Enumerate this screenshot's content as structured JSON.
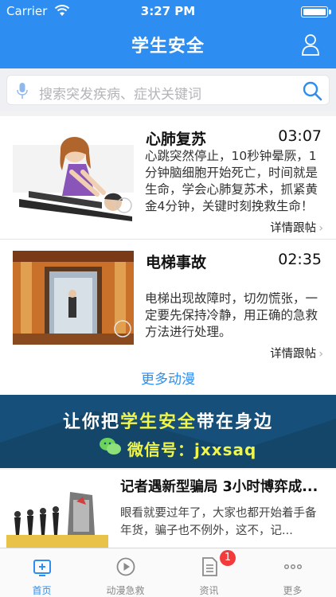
{
  "status_bar": {
    "carrier": "Carrier",
    "time": "3:27 PM"
  },
  "nav": {
    "title": "学生安全",
    "user_icon": "user-icon"
  },
  "search": {
    "placeholder": "搜索突发疾病、症状关键词",
    "mic_icon": "microphone-icon",
    "search_icon": "search-icon"
  },
  "list": {
    "items": [
      {
        "title": "心肺复苏",
        "duration": "03:07",
        "description": "心跳突然停止，10秒钟晕厥，1分钟脑细胞开始死亡，时间就是生命，学会心肺复苏术，抓紧黄金4分钟，关键时刻挽救生命！",
        "detail_label": "详情跟帖"
      },
      {
        "title": "电梯事故",
        "duration": "02:35",
        "description": "电梯出现故障时，切勿慌张，一定要先保持冷静，用正确的急救方法进行处理。",
        "detail_label": "详情跟帖"
      }
    ],
    "more_label": "更多动漫"
  },
  "banner": {
    "line1_before": "让你把",
    "line1_highlight": "学生安全",
    "line1_after": "带在身边",
    "line2": "微信号：jxxsaq"
  },
  "news": {
    "title": "记者遇新型骗局 3小时博弈成...",
    "description": "眼看就要过年了，大家也都开始着手备年货，骗子也不例外，这不，记..."
  },
  "tabbar": {
    "tabs": [
      {
        "label": "首页",
        "icon": "home-icon",
        "active": true
      },
      {
        "label": "动漫急救",
        "icon": "play-icon",
        "active": false
      },
      {
        "label": "资讯",
        "icon": "document-icon",
        "active": false,
        "badge": "1"
      },
      {
        "label": "更多",
        "icon": "more-icon",
        "active": false
      }
    ]
  },
  "colors": {
    "accent": "#2d8df0",
    "badge": "#f23b3b",
    "banner_bg": "#14476e",
    "banner_highlight": "#f0f54a"
  }
}
